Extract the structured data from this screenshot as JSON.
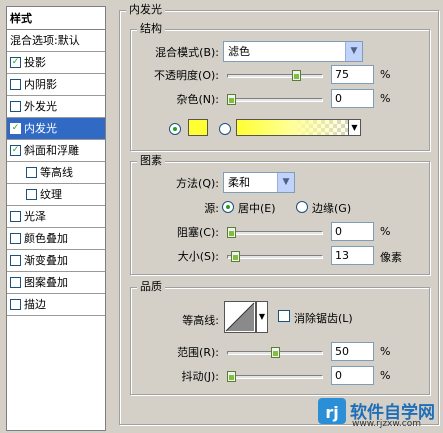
{
  "sidebar": {
    "title": "样式",
    "items": [
      {
        "label": "混合选项:默认",
        "checkbox": false,
        "checked": false,
        "selected": false,
        "sub": false
      },
      {
        "label": "投影",
        "checkbox": true,
        "checked": true,
        "selected": false,
        "sub": false
      },
      {
        "label": "内阴影",
        "checkbox": true,
        "checked": false,
        "selected": false,
        "sub": false
      },
      {
        "label": "外发光",
        "checkbox": true,
        "checked": false,
        "selected": false,
        "sub": false
      },
      {
        "label": "内发光",
        "checkbox": true,
        "checked": true,
        "selected": true,
        "sub": false
      },
      {
        "label": "斜面和浮雕",
        "checkbox": true,
        "checked": true,
        "selected": false,
        "sub": false
      },
      {
        "label": "等高线",
        "checkbox": true,
        "checked": false,
        "selected": false,
        "sub": true
      },
      {
        "label": "纹理",
        "checkbox": true,
        "checked": false,
        "selected": false,
        "sub": true
      },
      {
        "label": "光泽",
        "checkbox": true,
        "checked": false,
        "selected": false,
        "sub": false
      },
      {
        "label": "颜色叠加",
        "checkbox": true,
        "checked": false,
        "selected": false,
        "sub": false
      },
      {
        "label": "渐变叠加",
        "checkbox": true,
        "checked": false,
        "selected": false,
        "sub": false
      },
      {
        "label": "图案叠加",
        "checkbox": true,
        "checked": false,
        "selected": false,
        "sub": false
      },
      {
        "label": "描边",
        "checkbox": true,
        "checked": false,
        "selected": false,
        "sub": false
      }
    ]
  },
  "panel": {
    "title": "内发光",
    "structure": {
      "title": "结构",
      "blend_mode_label": "混合模式(B):",
      "blend_mode_value": "滤色",
      "opacity_label": "不透明度(O):",
      "opacity_value": "75",
      "opacity_unit": "%",
      "opacity_level": 0.75,
      "noise_label": "杂色(N):",
      "noise_value": "0",
      "noise_unit": "%",
      "noise_level": 0.0,
      "glow_color": "#ffff33"
    },
    "elements": {
      "title": "图素",
      "method_label": "方法(Q):",
      "method_value": "柔和",
      "source_label": "源:",
      "source_center": "居中(E)",
      "source_edge": "边缘(G)",
      "choke_label": "阻塞(C):",
      "choke_value": "0",
      "choke_unit": "%",
      "choke_level": 0.0,
      "size_label": "大小(S):",
      "size_value": "13",
      "size_unit": "像素",
      "size_level": 0.05
    },
    "quality": {
      "title": "品质",
      "contour_label": "等高线:",
      "antialias_label": "消除锯齿(L)",
      "range_label": "范围(R):",
      "range_value": "50",
      "range_unit": "%",
      "range_level": 0.5,
      "jitter_label": "抖动(J):",
      "jitter_value": "0",
      "jitter_unit": "%",
      "jitter_level": 0.0
    }
  },
  "watermark": {
    "line1": "软件自学网",
    "line2": "www.rjzxw.com"
  }
}
